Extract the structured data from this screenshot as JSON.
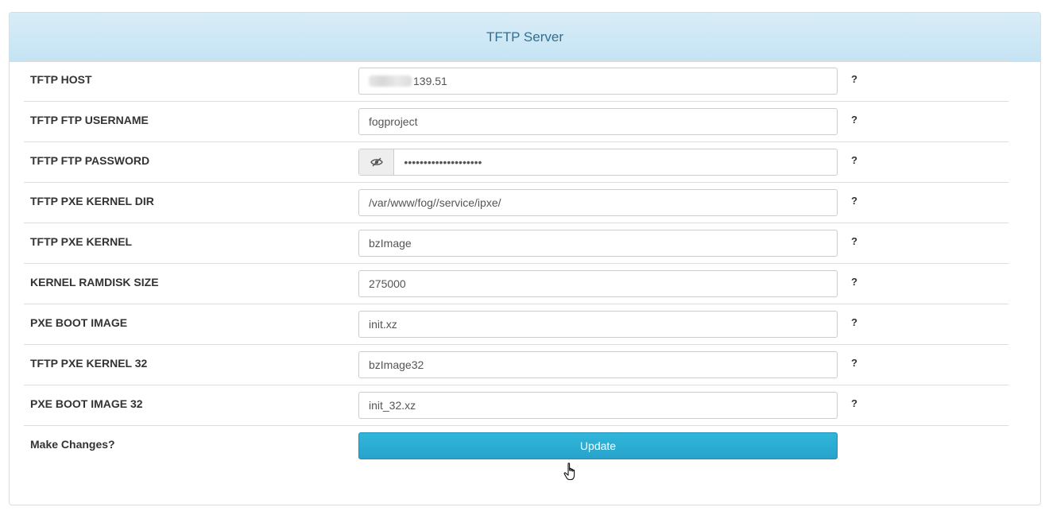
{
  "panel": {
    "title": "TFTP Server"
  },
  "fields": [
    {
      "label": "TFTP HOST",
      "value": "139.51",
      "help": "?"
    },
    {
      "label": "TFTP FTP USERNAME",
      "value": "fogproject",
      "help": "?"
    },
    {
      "label": "TFTP FTP PASSWORD",
      "value": "••••••••••••••••••••",
      "help": "?"
    },
    {
      "label": "TFTP PXE KERNEL DIR",
      "value": "/var/www/fog//service/ipxe/",
      "help": "?"
    },
    {
      "label": "TFTP PXE KERNEL",
      "value": "bzImage",
      "help": "?"
    },
    {
      "label": "KERNEL RAMDISK SIZE",
      "value": "275000",
      "help": "?"
    },
    {
      "label": "PXE BOOT IMAGE",
      "value": "init.xz",
      "help": "?"
    },
    {
      "label": "TFTP PXE KERNEL 32",
      "value": "bzImage32",
      "help": "?"
    },
    {
      "label": "PXE BOOT IMAGE 32",
      "value": "init_32.xz",
      "help": "?"
    }
  ],
  "actions": {
    "label": "Make Changes?",
    "update_label": "Update"
  },
  "icons": {
    "password_toggle": "eye-slash-icon",
    "cursor": "hand-pointer-icon"
  },
  "colors": {
    "heading_bg": "#d9edf7",
    "heading_text": "#31708f",
    "button": "#2aa7cf"
  }
}
